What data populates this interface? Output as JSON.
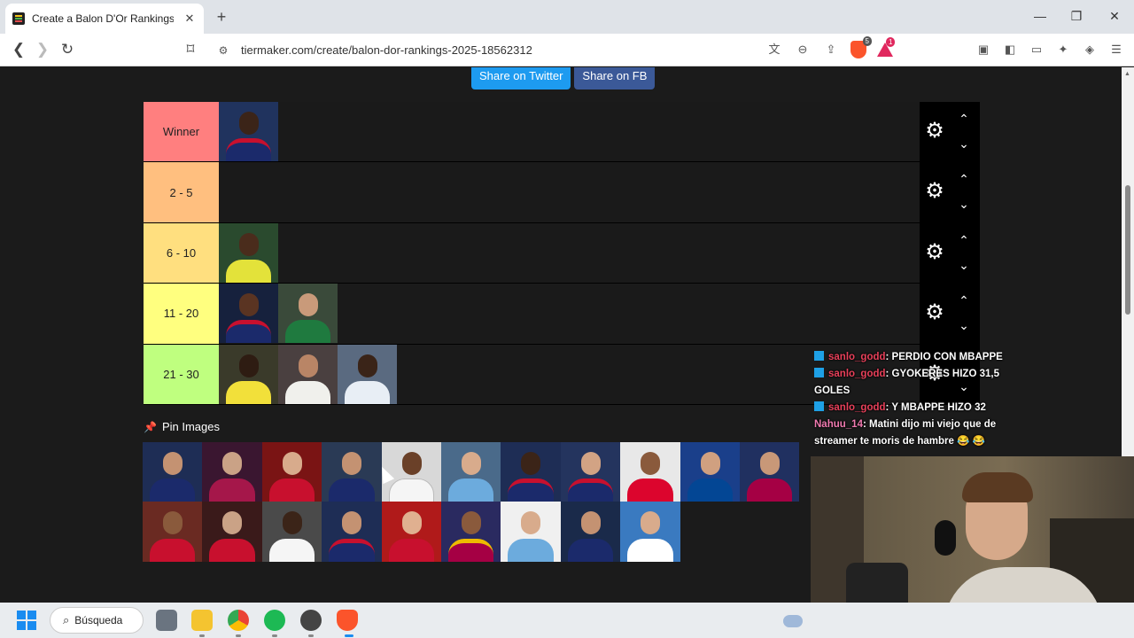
{
  "browser": {
    "tab_title": "Create a Balon D'Or Rankings 20",
    "tab_close": "✕",
    "new_tab": "+",
    "window_controls": {
      "minimize": "—",
      "maximize": "❐",
      "close": "✕"
    },
    "url": "tiermaker.com/create/balon-dor-rankings-2025-18562312",
    "brave_shield_count": "5",
    "rewards_count": "1"
  },
  "page": {
    "share_twitter": "Share on Twitter",
    "share_fb": "Share on FB",
    "pin_label": "Pin Images",
    "tiers": [
      {
        "label": "Winner",
        "color": "#ff7f7f"
      },
      {
        "label": "2 - 5",
        "color": "#ffbf7f"
      },
      {
        "label": "6 - 10",
        "color": "#ffdf7f"
      },
      {
        "label": "11 - 20",
        "color": "#ffff7f"
      },
      {
        "label": "21 - 30",
        "color": "#bfff7f"
      }
    ]
  },
  "chat": [
    {
      "user": "sanlo_godd",
      "message": ": PERDIO CON MBAPPE"
    },
    {
      "user": "sanlo_godd",
      "message": ": GYOKERES HIZO 31,5 GOLES"
    },
    {
      "user": "sanlo_godd",
      "message": ": Y MBAPPE HIZO 32"
    },
    {
      "user": "Nahuu_14",
      "message": ": Matini dijo mi viejo que de streamer te moris de hambre 😂 😂"
    }
  ],
  "taskbar": {
    "search_label": "Búsqueda"
  }
}
